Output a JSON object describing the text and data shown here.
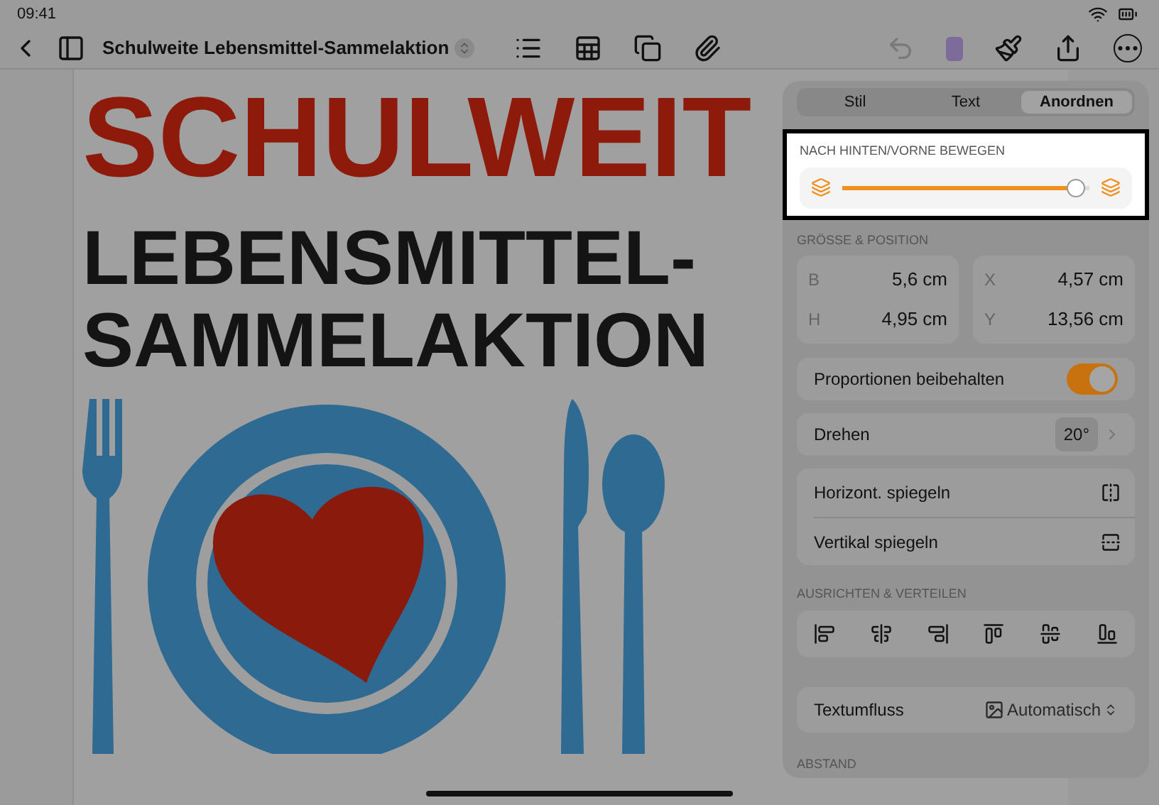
{
  "status_bar": {
    "time": "09:41"
  },
  "toolbar": {
    "title": "Schulweite Lebensmittel-Sammelaktion"
  },
  "document": {
    "headline": "SCHULWEIT",
    "subheadline": [
      "LEBENSMITTEL-",
      "SAMMELAKTION"
    ]
  },
  "panel": {
    "tabs": [
      {
        "label": "Stil",
        "selected": false
      },
      {
        "label": "Text",
        "selected": false
      },
      {
        "label": "Anordnen",
        "selected": true
      }
    ],
    "layer_order": {
      "title": "NACH HINTEN/VORNE BEWEGEN",
      "level": 0.98
    },
    "size_position": {
      "title": "GRÖSSE & POSITION",
      "fields": [
        {
          "label": "B",
          "value": "5,6 cm"
        },
        {
          "label": "X",
          "value": "4,57 cm"
        },
        {
          "label": "H",
          "value": "4,95 cm"
        },
        {
          "label": "Y",
          "value": "13,56 cm"
        }
      ]
    },
    "proportions": {
      "label": "Proportionen beibehalten",
      "on": true
    },
    "rotate": {
      "label": "Drehen",
      "value": "20°"
    },
    "flip": [
      {
        "label": "Horizont. spiegeln"
      },
      {
        "label": "Vertikal spiegeln"
      }
    ],
    "align": {
      "title": "AUSRICHTEN & VERTEILEN"
    },
    "text_wrap": {
      "label": "Textumfluss",
      "value": "Automatisch"
    },
    "spacing": {
      "title": "ABSTAND"
    }
  }
}
